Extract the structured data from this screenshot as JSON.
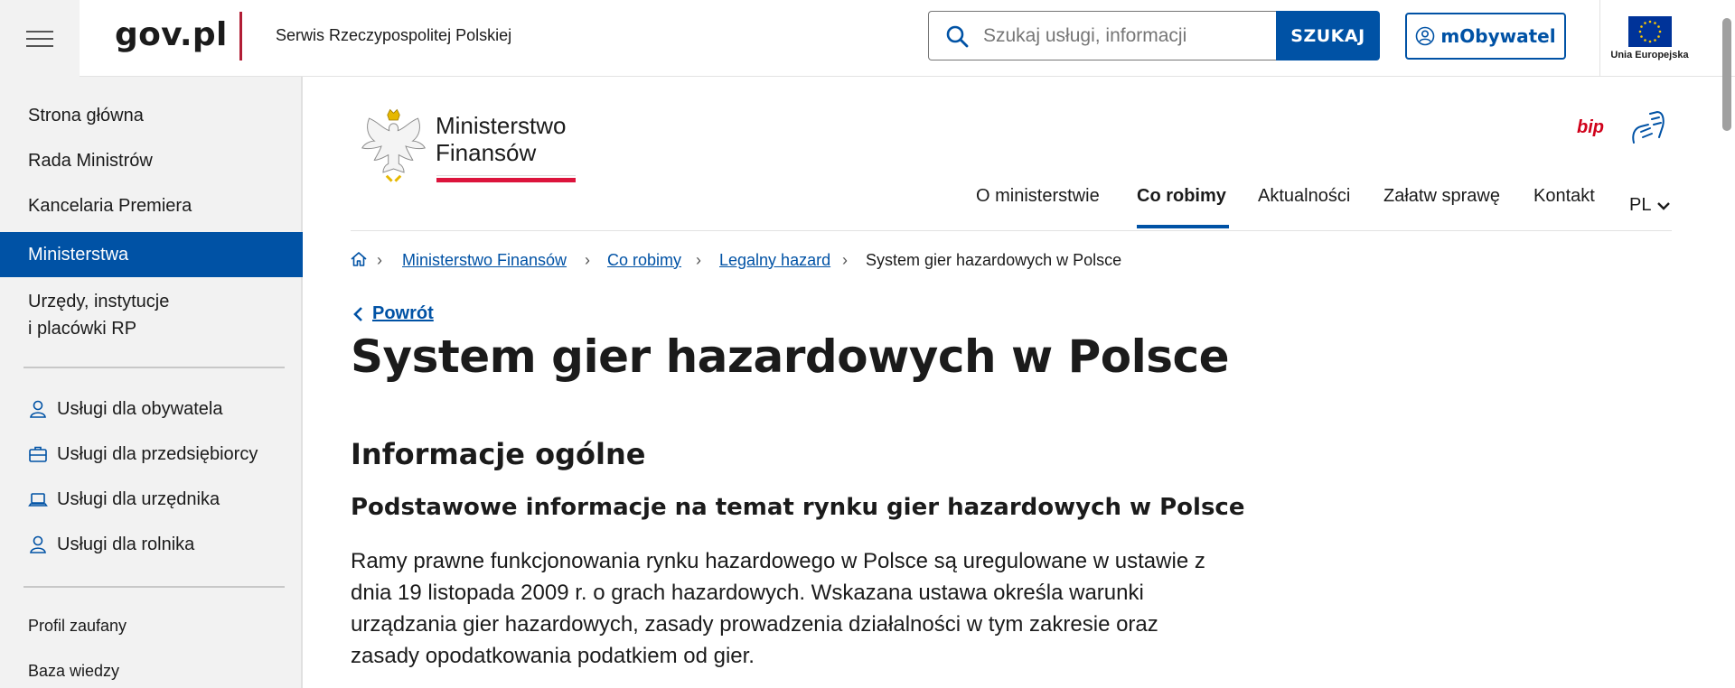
{
  "header": {
    "logo": "gov.pl",
    "service_name": "Serwis Rzeczypospolitej Polskiej",
    "search": {
      "placeholder": "Szukaj usługi, informacji",
      "button_label": "SZUKAJ"
    },
    "mobywatel_label": "mObywatel",
    "eu_label": "Unia Europejska"
  },
  "sidebar": {
    "items": [
      {
        "label": "Strona główna"
      },
      {
        "label": "Rada Ministrów"
      },
      {
        "label": "Kancelaria Premiera"
      },
      {
        "label": "Ministerstwa"
      },
      {
        "label_line1": "Urzędy, instytucje",
        "label_line2": "i placówki RP"
      }
    ],
    "services": [
      {
        "label": "Usługi dla obywatela",
        "icon": "person-icon"
      },
      {
        "label": "Usługi dla przedsiębiorcy",
        "icon": "briefcase-icon"
      },
      {
        "label": "Usługi dla urzędnika",
        "icon": "laptop-icon"
      },
      {
        "label": "Usługi dla rolnika",
        "icon": "person-icon"
      }
    ],
    "extra": [
      {
        "label": "Profil zaufany"
      },
      {
        "label": "Baza wiedzy"
      }
    ]
  },
  "ministry": {
    "line1": "Ministerstwo",
    "line2": "Finansów"
  },
  "bip_label": "bip",
  "nav": {
    "items": [
      "O ministerstwie",
      "Co robimy",
      "Aktualności",
      "Załatw sprawę",
      "Kontakt"
    ],
    "lang": "PL"
  },
  "breadcrumb": {
    "links": [
      "Ministerstwo Finansów",
      "Co robimy",
      "Legalny hazard"
    ],
    "current": "System gier hazardowych w Polsce"
  },
  "back_label": "Powrót",
  "content": {
    "title": "System gier hazardowych w Polsce",
    "section": "Informacje ogólne",
    "subsection": "Podstawowe informacje na temat rynku gier hazardowych w Polsce",
    "paragraph_lines": [
      "Ramy prawne funkcjonowania rynku hazardowego w Polsce są uregulowane w ustawie z",
      "dnia 19 listopada 2009 r. o grach hazardowych. Wskazana ustawa określa warunki",
      "urządzania gier hazardowych, zasady prowadzenia działalności w tym zakresie oraz",
      "zasady opodatkowania podatkiem od gier."
    ]
  },
  "colors": {
    "primary": "#0052a5",
    "accent_red": "#dc143c",
    "sidebar_bg": "#f2f2f2"
  }
}
